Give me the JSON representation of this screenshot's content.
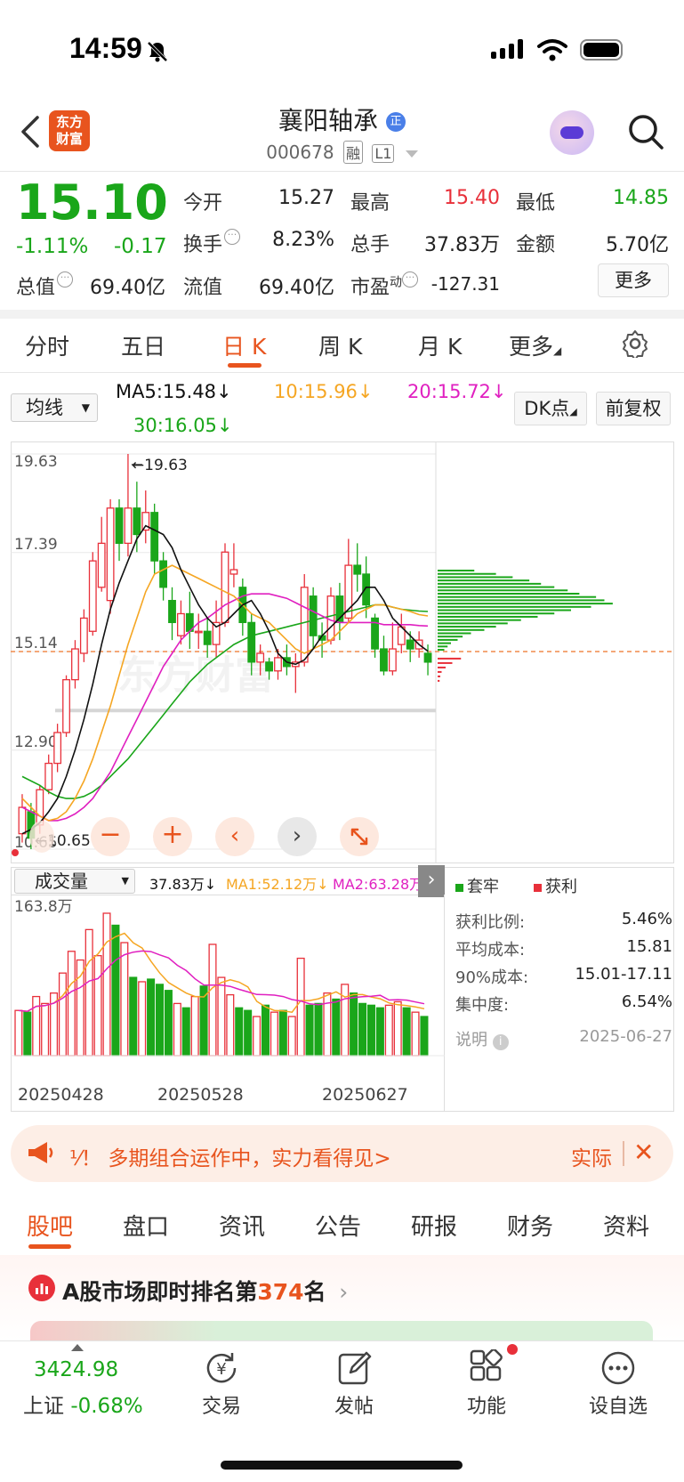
{
  "status": {
    "time": "14:59"
  },
  "header": {
    "logo_line1": "东方",
    "logo_line2": "财富",
    "title": "襄阳轴承",
    "code": "000678",
    "tag1": "融",
    "tag2": "L1"
  },
  "quote": {
    "price": "15.10",
    "change_pct": "-1.11%",
    "change": "-0.17",
    "open_label": "今开",
    "open": "15.27",
    "high_label": "最高",
    "high": "15.40",
    "low_label": "最低",
    "low": "14.85",
    "turnover_label": "换手",
    "turnover": "8.23%",
    "volume_label": "总手",
    "volume": "37.83万",
    "amount_label": "金额",
    "amount": "5.70亿",
    "mcap_label": "总值",
    "mcap": "69.40亿",
    "float_label": "流值",
    "float": "69.40亿",
    "pe_label": "市盈",
    "pe_sup": "动",
    "pe": "-127.31",
    "more": "更多"
  },
  "period_tabs": [
    "分时",
    "五日",
    "日 K",
    "周 K",
    "月 K",
    "更多"
  ],
  "ma": {
    "selector": "均线",
    "ma5": "MA5:15.48↓",
    "ma10": "10:15.96↓",
    "ma20": "20:15.72↓",
    "ma30": "30:16.05↓",
    "dk": "DK点",
    "fq": "前复权"
  },
  "colors": {
    "up": "#e8303a",
    "down": "#1aa61a",
    "accent": "#e8541e",
    "ma5": "#111111",
    "ma10": "#f5a623",
    "ma20": "#e020c0",
    "ma30": "#1aa61a"
  },
  "chart_data": {
    "type": "candlestick",
    "ylim": [
      10.65,
      19.63
    ],
    "y_ticks": [
      "19.63",
      "17.39",
      "15.14",
      "12.90",
      "10.65"
    ],
    "current_line": "15.14",
    "max_label": "19.63",
    "min_label": "10.65",
    "x_labels": [
      "20250428",
      "20250528",
      "20250627"
    ],
    "candles": [
      {
        "o": 11.0,
        "c": 11.6,
        "h": 11.9,
        "l": 10.8
      },
      {
        "o": 11.5,
        "c": 10.9,
        "h": 11.7,
        "l": 10.65
      },
      {
        "o": 11.2,
        "c": 12.0,
        "h": 12.1,
        "l": 11.0
      },
      {
        "o": 12.0,
        "c": 12.6,
        "h": 12.8,
        "l": 11.9
      },
      {
        "o": 12.6,
        "c": 13.3,
        "h": 13.5,
        "l": 12.4
      },
      {
        "o": 13.3,
        "c": 14.5,
        "h": 14.6,
        "l": 13.2
      },
      {
        "o": 14.5,
        "c": 15.2,
        "h": 15.4,
        "l": 14.3
      },
      {
        "o": 15.1,
        "c": 15.9,
        "h": 16.1,
        "l": 14.9
      },
      {
        "o": 15.6,
        "c": 17.2,
        "h": 17.4,
        "l": 15.5
      },
      {
        "o": 16.6,
        "c": 17.6,
        "h": 18.2,
        "l": 16.5
      },
      {
        "o": 16.3,
        "c": 18.4,
        "h": 18.6,
        "l": 16.0
      },
      {
        "o": 18.4,
        "c": 17.6,
        "h": 18.6,
        "l": 17.2
      },
      {
        "o": 17.6,
        "c": 18.4,
        "h": 19.63,
        "l": 17.3
      },
      {
        "o": 18.4,
        "c": 17.8,
        "h": 19.0,
        "l": 17.4
      },
      {
        "o": 17.9,
        "c": 18.3,
        "h": 18.8,
        "l": 17.6
      },
      {
        "o": 18.3,
        "c": 17.2,
        "h": 18.5,
        "l": 16.9
      },
      {
        "o": 17.2,
        "c": 16.6,
        "h": 17.4,
        "l": 16.3
      },
      {
        "o": 16.3,
        "c": 15.8,
        "h": 16.6,
        "l": 15.4
      },
      {
        "o": 15.5,
        "c": 16.0,
        "h": 16.3,
        "l": 15.3
      },
      {
        "o": 16.0,
        "c": 15.6,
        "h": 16.5,
        "l": 15.2
      },
      {
        "o": 15.6,
        "c": 15.6,
        "h": 16.0,
        "l": 15.2
      },
      {
        "o": 15.6,
        "c": 15.3,
        "h": 15.9,
        "l": 15.0
      },
      {
        "o": 15.3,
        "c": 15.8,
        "h": 16.3,
        "l": 15.0
      },
      {
        "o": 15.8,
        "c": 17.4,
        "h": 17.6,
        "l": 15.7
      },
      {
        "o": 16.9,
        "c": 17.0,
        "h": 17.6,
        "l": 16.6
      },
      {
        "o": 16.6,
        "c": 15.8,
        "h": 16.8,
        "l": 15.5
      },
      {
        "o": 15.8,
        "c": 14.9,
        "h": 16.0,
        "l": 14.6
      },
      {
        "o": 14.9,
        "c": 15.1,
        "h": 15.3,
        "l": 14.6
      },
      {
        "o": 14.9,
        "c": 14.7,
        "h": 15.0,
        "l": 14.5
      },
      {
        "o": 14.7,
        "c": 15.0,
        "h": 15.2,
        "l": 14.5
      },
      {
        "o": 15.0,
        "c": 14.8,
        "h": 15.3,
        "l": 14.6
      },
      {
        "o": 14.8,
        "c": 14.9,
        "h": 15.1,
        "l": 14.2
      },
      {
        "o": 14.9,
        "c": 16.6,
        "h": 16.9,
        "l": 14.8
      },
      {
        "o": 16.4,
        "c": 15.5,
        "h": 16.6,
        "l": 15.2
      },
      {
        "o": 15.5,
        "c": 15.4,
        "h": 15.8,
        "l": 15.0
      },
      {
        "o": 15.4,
        "c": 16.4,
        "h": 16.6,
        "l": 15.3
      },
      {
        "o": 16.4,
        "c": 15.8,
        "h": 16.7,
        "l": 15.4
      },
      {
        "o": 15.9,
        "c": 17.1,
        "h": 17.7,
        "l": 15.8
      },
      {
        "o": 17.1,
        "c": 16.9,
        "h": 17.6,
        "l": 16.5
      },
      {
        "o": 16.9,
        "c": 16.2,
        "h": 17.3,
        "l": 15.9
      },
      {
        "o": 15.9,
        "c": 15.2,
        "h": 16.0,
        "l": 15.0
      },
      {
        "o": 15.2,
        "c": 14.7,
        "h": 15.5,
        "l": 14.6
      },
      {
        "o": 14.7,
        "c": 15.2,
        "h": 15.8,
        "l": 14.6
      },
      {
        "o": 15.3,
        "c": 15.7,
        "h": 16.0,
        "l": 15.1
      },
      {
        "o": 15.4,
        "c": 15.2,
        "h": 15.6,
        "l": 14.9
      },
      {
        "o": 15.2,
        "c": 15.4,
        "h": 15.6,
        "l": 15.0
      },
      {
        "o": 15.1,
        "c": 14.9,
        "h": 15.3,
        "l": 14.6
      }
    ],
    "ma5": [
      11.0,
      11.1,
      11.25,
      11.5,
      11.8,
      12.3,
      12.9,
      13.6,
      14.4,
      15.3,
      16.1,
      16.7,
      17.2,
      17.7,
      18.0,
      17.9,
      17.8,
      17.5,
      17.0,
      16.6,
      16.2,
      15.9,
      15.7,
      15.8,
      16.0,
      16.2,
      16.3,
      16.0,
      15.6,
      15.1,
      14.9,
      14.85,
      14.95,
      15.2,
      15.5,
      15.7,
      15.9,
      16.1,
      16.3,
      16.6,
      16.6,
      16.3,
      15.9,
      15.7,
      15.5,
      15.3,
      15.15
    ],
    "ma10": [
      11.8,
      11.6,
      11.4,
      11.3,
      11.35,
      11.5,
      11.8,
      12.2,
      12.7,
      13.3,
      13.9,
      14.6,
      15.3,
      15.9,
      16.5,
      16.9,
      17.0,
      17.1,
      17.0,
      16.9,
      16.8,
      16.7,
      16.6,
      16.5,
      16.4,
      16.2,
      16.0,
      15.9,
      15.8,
      15.6,
      15.4,
      15.2,
      15.1,
      15.2,
      15.3,
      15.4,
      15.6,
      15.8,
      16.0,
      16.1,
      16.2,
      16.2,
      16.15,
      16.1,
      16.05,
      15.98,
      15.95
    ],
    "ma20": [
      11.6,
      11.5,
      11.4,
      11.3,
      11.3,
      11.35,
      11.45,
      11.6,
      11.8,
      12.1,
      12.4,
      12.8,
      13.2,
      13.6,
      14.0,
      14.4,
      14.8,
      15.1,
      15.4,
      15.6,
      15.8,
      15.9,
      16.05,
      16.2,
      16.3,
      16.4,
      16.45,
      16.45,
      16.45,
      16.4,
      16.35,
      16.25,
      16.15,
      16.05,
      15.95,
      15.85,
      15.8,
      15.8,
      15.8,
      15.8,
      15.8,
      15.75,
      15.75,
      15.75,
      15.75,
      15.73,
      15.72
    ],
    "ma30": [
      12.3,
      12.2,
      12.1,
      11.95,
      11.85,
      11.8,
      11.8,
      11.85,
      11.95,
      12.1,
      12.3,
      12.5,
      12.7,
      12.95,
      13.2,
      13.45,
      13.7,
      13.95,
      14.2,
      14.45,
      14.65,
      14.85,
      15.0,
      15.15,
      15.3,
      15.4,
      15.5,
      15.55,
      15.6,
      15.65,
      15.7,
      15.75,
      15.8,
      15.85,
      15.9,
      15.95,
      16.0,
      16.05,
      16.1,
      16.15,
      16.2,
      16.2,
      16.15,
      16.1,
      16.08,
      16.06,
      16.05
    ],
    "profile_green": [
      0.22,
      0.35,
      0.45,
      0.55,
      0.62,
      0.7,
      0.78,
      0.85,
      0.95,
      1.0,
      1.05,
      0.92,
      0.8,
      0.7,
      0.6,
      0.5,
      0.42,
      0.35,
      0.28,
      0.2,
      0.15,
      0.12,
      0.08,
      0.06,
      0.04
    ],
    "profile_red": [
      0.35,
      0.22,
      0.12,
      0.06,
      0.04,
      0.03
    ],
    "volume_label": "成交量",
    "volume_value": "37.83万↓",
    "vol_ma1": "MA1:52.12万↓",
    "vol_ma2": "MA2:63.28万↓",
    "volume_max_label": "163.8万",
    "volume": [
      52,
      50,
      68,
      60,
      72,
      95,
      120,
      110,
      145,
      115,
      163.8,
      150,
      130,
      90,
      85,
      88,
      82,
      75,
      60,
      55,
      68,
      80,
      128,
      90,
      70,
      55,
      52,
      45,
      58,
      50,
      52,
      45,
      112,
      58,
      60,
      72,
      65,
      82,
      72,
      60,
      58,
      55,
      58,
      62,
      55,
      50,
      45
    ]
  },
  "chip_panel": {
    "legend_trap": "套牢",
    "legend_profit": "获利",
    "rows": [
      {
        "label": "获利比例:",
        "value": "5.46%"
      },
      {
        "label": "平均成本:",
        "value": "15.81"
      },
      {
        "label": "90%成本:",
        "value": "15.01-17.11"
      },
      {
        "label": "集中度:",
        "value": "6.54%"
      }
    ],
    "note": "说明",
    "date": "2025-06-27"
  },
  "banner": {
    "text": "⅟！ 多期组合运作中，实力看得见>",
    "action": "实际"
  },
  "bottom_tabs": [
    "股吧",
    "盘口",
    "资讯",
    "公告",
    "研报",
    "财务",
    "资料"
  ],
  "rank": {
    "prefix": "A股市场即时排名第",
    "number": "374",
    "suffix": "名"
  },
  "nav": {
    "index_value": "3424.98",
    "index_name": "上证",
    "index_change": "-0.68%",
    "items": [
      "交易",
      "发帖",
      "功能",
      "设自选"
    ]
  }
}
